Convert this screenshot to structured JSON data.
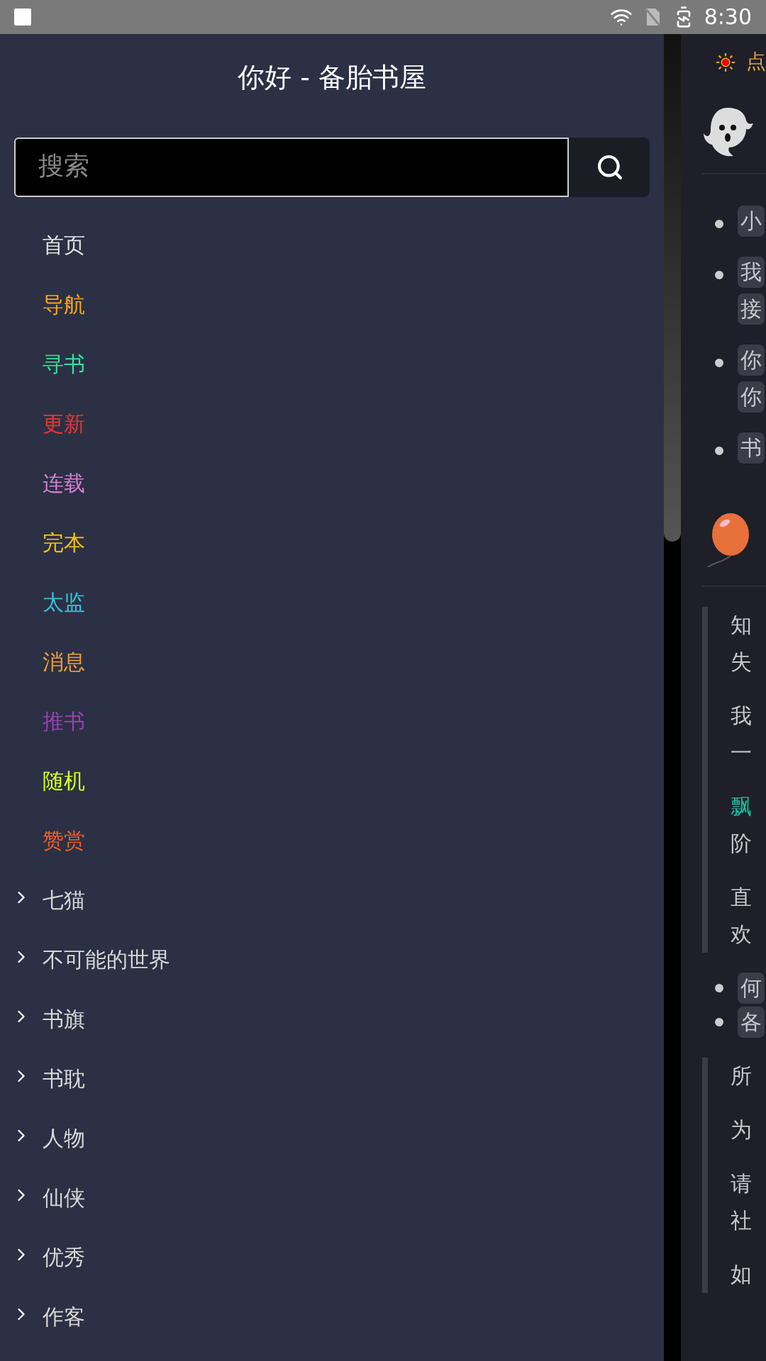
{
  "status_bar": {
    "time": "8:30"
  },
  "drawer": {
    "title": "你好 - 备胎书屋",
    "search": {
      "placeholder": "搜索"
    },
    "items": [
      {
        "kind": "link",
        "label": "首页",
        "color": "#e4e4e4"
      },
      {
        "kind": "link",
        "label": "导航",
        "color": "#f5a623"
      },
      {
        "kind": "link",
        "label": "寻书",
        "color": "#2ee59d"
      },
      {
        "kind": "link",
        "label": "更新",
        "color": "#e53935"
      },
      {
        "kind": "link",
        "label": "连载",
        "color": "#d17fcf"
      },
      {
        "kind": "link",
        "label": "完本",
        "color": "#f1c40f"
      },
      {
        "kind": "link",
        "label": "太监",
        "color": "#2fc4d9"
      },
      {
        "kind": "link",
        "label": "消息",
        "color": "#f0a030"
      },
      {
        "kind": "link",
        "label": "推书",
        "color": "#9b3fb5"
      },
      {
        "kind": "link",
        "label": "随机",
        "color": "#d4ff1e"
      },
      {
        "kind": "link",
        "label": "赞赏",
        "color": "#f0602a"
      },
      {
        "kind": "group",
        "label": "七猫",
        "expanded": false
      },
      {
        "kind": "group",
        "label": "不可能的世界",
        "expanded": false
      },
      {
        "kind": "group",
        "label": "书旗",
        "expanded": false
      },
      {
        "kind": "group",
        "label": "书耽",
        "expanded": false
      },
      {
        "kind": "group",
        "label": "人物",
        "expanded": false
      },
      {
        "kind": "group",
        "label": "仙侠",
        "expanded": false
      },
      {
        "kind": "group",
        "label": "优秀",
        "expanded": false
      },
      {
        "kind": "group",
        "label": "作客",
        "expanded": false
      }
    ]
  },
  "content": {
    "notice": "点",
    "list_1": [
      [
        "小"
      ],
      [
        "我",
        "接"
      ],
      [
        "你",
        "你"
      ],
      [
        "书"
      ]
    ],
    "quote_1": [
      {
        "text": "知",
        "text2": "失",
        "accent": false
      },
      {
        "text": "我",
        "text2": "一",
        "accent": false
      },
      {
        "text": "飘",
        "text2": "阶",
        "accent": true
      },
      {
        "text": "直",
        "text2": "欢",
        "accent": false
      }
    ],
    "list_2": [
      "何",
      "各"
    ],
    "quote_2": [
      [
        "所"
      ],
      [
        "为"
      ],
      [
        "请",
        "社"
      ],
      [
        "如"
      ]
    ]
  }
}
